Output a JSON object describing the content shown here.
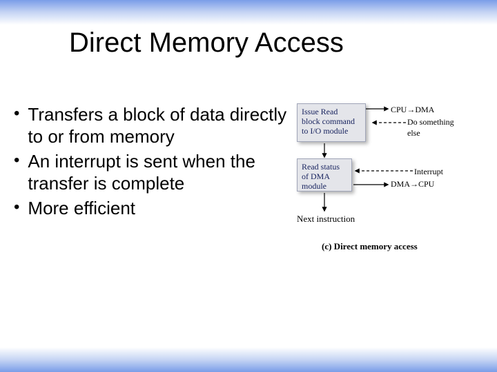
{
  "title": "Direct Memory Access",
  "bullets": [
    "Transfers a block of data directly to or from memory",
    "An interrupt is sent when the transfer is complete",
    "More efficient"
  ],
  "diagram": {
    "box1": "Issue Read\nblock command\nto I/O module",
    "box2": "Read status\nof DMA\nmodule",
    "cpu_to_dma": "CPU→DMA",
    "do_something": "Do something",
    "else_label": "else",
    "interrupt": "Interrupt",
    "dma_to_cpu": "DMA→CPU",
    "next": "Next instruction",
    "caption": "(c) Direct memory access"
  }
}
